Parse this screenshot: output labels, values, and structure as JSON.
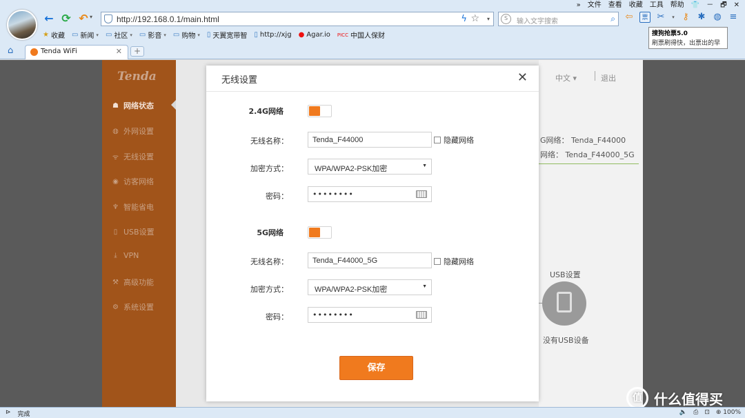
{
  "browser": {
    "address_url": "http://192.168.0.1/main.html",
    "search_placeholder": "输入文字搜索",
    "menu": [
      "»",
      "文件",
      "查看",
      "收藏",
      "工具",
      "帮助",
      "👕",
      "－",
      "🗗",
      "✕"
    ],
    "bookmarks": [
      {
        "label": "收藏",
        "icon": "star-icon",
        "caret": false
      },
      {
        "label": "新闻",
        "icon": "folder-icon",
        "caret": true
      },
      {
        "label": "社区",
        "icon": "folder-icon",
        "caret": true
      },
      {
        "label": "影音",
        "icon": "folder-icon",
        "caret": true
      },
      {
        "label": "购物",
        "icon": "folder-icon",
        "caret": true
      },
      {
        "label": "天翼宽带智",
        "icon": "page-icon",
        "caret": false
      },
      {
        "label": "http://xjg",
        "icon": "page-icon",
        "caret": false
      },
      {
        "label": "Agar.io",
        "icon": "red-dot-icon",
        "caret": false
      },
      {
        "label": "中国人保财",
        "icon": "picc-icon",
        "caret": false
      }
    ],
    "tooltip": {
      "title": "搜狗抢票5.0",
      "desc": "刷票刷得快，出票出的早"
    },
    "tab": {
      "label": "Tenda WiFi",
      "close": "✕"
    },
    "newtab": "+",
    "status": {
      "left": "完成",
      "zoom": "100%"
    }
  },
  "router": {
    "brand": "Tenda",
    "sidebar": [
      {
        "label": "网络状态",
        "icon": "status-icon",
        "active": true
      },
      {
        "label": "外网设置",
        "icon": "globe-icon",
        "active": false
      },
      {
        "label": "无线设置",
        "icon": "wifi-icon",
        "active": false
      },
      {
        "label": "访客网络",
        "icon": "guest-icon",
        "active": false
      },
      {
        "label": "智能省电",
        "icon": "bulb-icon",
        "active": false
      },
      {
        "label": "USB设置",
        "icon": "usb-icon",
        "active": false
      },
      {
        "label": "VPN",
        "icon": "vpn-icon",
        "active": false
      },
      {
        "label": "高级功能",
        "icon": "tools-icon",
        "active": false
      },
      {
        "label": "系统设置",
        "icon": "settings-icon",
        "active": false
      }
    ],
    "header": {
      "language": "中文",
      "exit": "退出"
    },
    "background": {
      "ssid_24": "G网络： Tenda_F44000",
      "ssid_5": "网络： Tenda_F44000_5G",
      "usb_title": "USB设置",
      "usb_status": "没有USB设备"
    }
  },
  "modal": {
    "title": "无线设置",
    "close": "✕",
    "band_24": {
      "label": "2.4G网络",
      "enabled": true,
      "ssid_label": "无线名称：",
      "ssid_value": "Tenda_F44000",
      "hide_label": "隐藏网络",
      "enc_label": "加密方式：",
      "enc_value": "WPA/WPA2-PSK加密",
      "pwd_label": "密码：",
      "pwd_value": "••••••••"
    },
    "band_5": {
      "label": "5G网络",
      "enabled": true,
      "ssid_label": "无线名称：",
      "ssid_value": "Tenda_F44000_5G",
      "hide_label": "隐藏网络",
      "enc_label": "加密方式：",
      "enc_value": "WPA/WPA2-PSK加密",
      "pwd_label": "密码：",
      "pwd_value": "••••••••"
    },
    "save_label": "保存"
  },
  "watermark": {
    "text": "什么值得买",
    "logo": "值"
  },
  "colors": {
    "accent": "#f07a1e",
    "sidebar": "#a1541a",
    "chrome": "#dce9f6"
  }
}
